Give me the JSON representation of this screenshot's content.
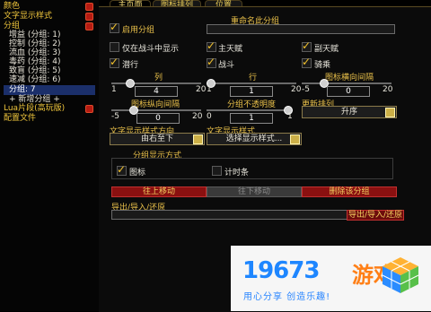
{
  "sidebar": {
    "items": [
      {
        "label": "颜色",
        "type": "head"
      },
      {
        "label": "文字显示样式",
        "type": "head"
      },
      {
        "label": "分组",
        "type": "head"
      },
      {
        "label": "增益 (分组: 1)",
        "type": "sub"
      },
      {
        "label": "控制 (分组: 2)",
        "type": "sub"
      },
      {
        "label": "流血 (分组: 3)",
        "type": "sub"
      },
      {
        "label": "毒药 (分组: 4)",
        "type": "sub"
      },
      {
        "label": "致盲 (分组: 5)",
        "type": "sub"
      },
      {
        "label": "速减 (分组: 6)",
        "type": "sub"
      },
      {
        "label": "分组: 7",
        "type": "sel"
      },
      {
        "label": "+ 新增分组 +",
        "type": "sub"
      },
      {
        "label": "Lua片段(高玩版)",
        "type": "head"
      },
      {
        "label": "配置文件",
        "type": "head"
      }
    ]
  },
  "tabs": [
    "主页面",
    "图标排列",
    "位置"
  ],
  "options": {
    "enable_group": "启用分组",
    "rename_group": "重命名此分组",
    "only_in_combat": "仅在战斗中显示",
    "main_talent": "主天赋",
    "off_talent": "副天赋",
    "stealth": "潜行",
    "combat": "战斗",
    "mounted": "骑乘"
  },
  "sliders": {
    "columns": {
      "label": "列",
      "min": "1",
      "max": "20",
      "value": "4"
    },
    "rows": {
      "label": "行",
      "min": "1",
      "max": "20",
      "value": "1"
    },
    "h_spacing": {
      "label": "图标横向间隔",
      "min": "-5",
      "max": "20",
      "value": "0"
    },
    "v_spacing": {
      "label": "图标纵向间隔",
      "min": "-5",
      "max": "20",
      "value": "0"
    },
    "opacity": {
      "label": "分组不透明度",
      "min": "0",
      "max": "1",
      "value": "1"
    }
  },
  "sort": {
    "label": "更新排列",
    "value": "升序"
  },
  "text_direction": {
    "label": "文字显示样式方向",
    "value": "由右至下"
  },
  "text_style": {
    "label": "文字显示样式",
    "value": "选择显示样式..."
  },
  "display_mode": {
    "title": "分组显示方式",
    "icon": "图标",
    "timer_bar": "计时条"
  },
  "buttons": {
    "move_up": "往上移动",
    "move_down": "往下移动",
    "delete": "删除该分组"
  },
  "import_export": {
    "label": "导出/导入/还原",
    "button": "导出/导入/还原"
  },
  "watermark": {
    "number": "19673",
    "name": "游戏",
    "slogan": "用心分享 创造乐趣!"
  }
}
